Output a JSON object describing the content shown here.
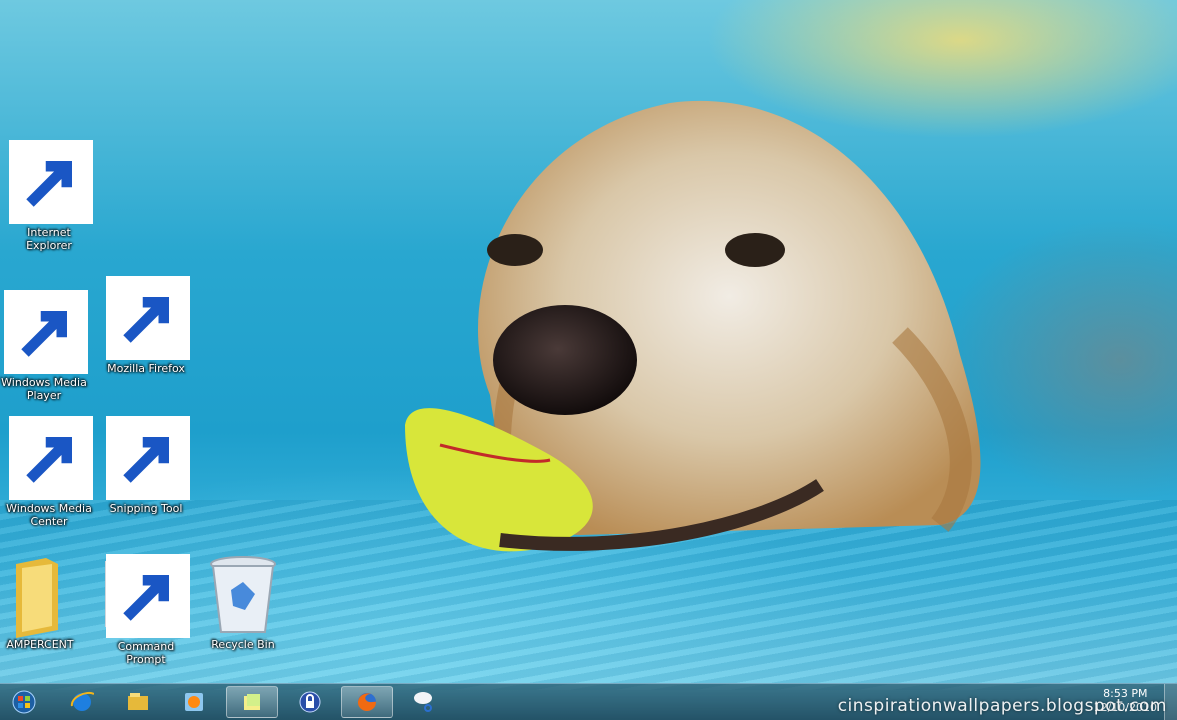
{
  "desktop": {
    "icons": [
      {
        "label": "Internet Explorer",
        "icon": "internet-explorer-icon"
      },
      {
        "label": "Windows Media Player",
        "icon": "windows-media-player-icon"
      },
      {
        "label": "Mozilla Firefox",
        "icon": "firefox-icon"
      },
      {
        "label": "Windows Media Center",
        "icon": "windows-media-center-icon"
      },
      {
        "label": "Snipping Tool",
        "icon": "snipping-tool-icon"
      },
      {
        "label": "AMPERCENT",
        "icon": "folder-icon"
      },
      {
        "label": "Command Prompt",
        "icon": "command-prompt-icon"
      },
      {
        "label": "Recycle Bin",
        "icon": "recycle-bin-icon"
      }
    ]
  },
  "taskbar": {
    "buttons": [
      {
        "icon": "start-orb-icon"
      },
      {
        "icon": "internet-explorer-icon"
      },
      {
        "icon": "windows-explorer-icon"
      },
      {
        "icon": "windows-media-player-icon"
      },
      {
        "icon": "sticky-notes-icon"
      },
      {
        "icon": "lock-icon"
      },
      {
        "icon": "firefox-icon"
      },
      {
        "icon": "snipping-tool-icon"
      }
    ],
    "clock": {
      "time": "8:53 PM",
      "date": "12/10/2010"
    }
  },
  "watermark": "cinspirationwallpapers.blogspot.com",
  "colors": {
    "water": "#1e9fcc",
    "taskbar": "#1f4f63"
  }
}
